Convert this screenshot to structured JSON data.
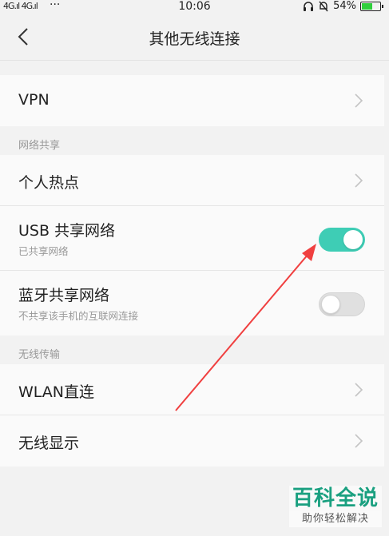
{
  "status_bar": {
    "signal_text": "4G.ıl 4G.ıl",
    "more": "···",
    "time": "10:06",
    "battery_percent": "54%",
    "battery_level": 0.54
  },
  "nav": {
    "title": "其他无线连接",
    "back_icon": "chevron-left-icon"
  },
  "vpn": {
    "label": "VPN"
  },
  "network_sharing": {
    "header": "网络共享",
    "hotspot": {
      "label": "个人热点"
    },
    "usb": {
      "label": "USB 共享网络",
      "sub": "已共享网络",
      "enabled": true
    },
    "bluetooth": {
      "label": "蓝牙共享网络",
      "sub": "不共享该手机的互联网连接",
      "enabled": false
    }
  },
  "wireless_transfer": {
    "header": "无线传输",
    "wlan_direct": {
      "label": "WLAN直连"
    },
    "wireless_display": {
      "label": "无线显示"
    }
  },
  "watermark": {
    "title": "百科全说",
    "sub": "助你轻松解决"
  },
  "colors": {
    "toggle_on": "#3ecdb5",
    "toggle_off": "#e0e0e0",
    "annotation_arrow": "#f04040"
  }
}
